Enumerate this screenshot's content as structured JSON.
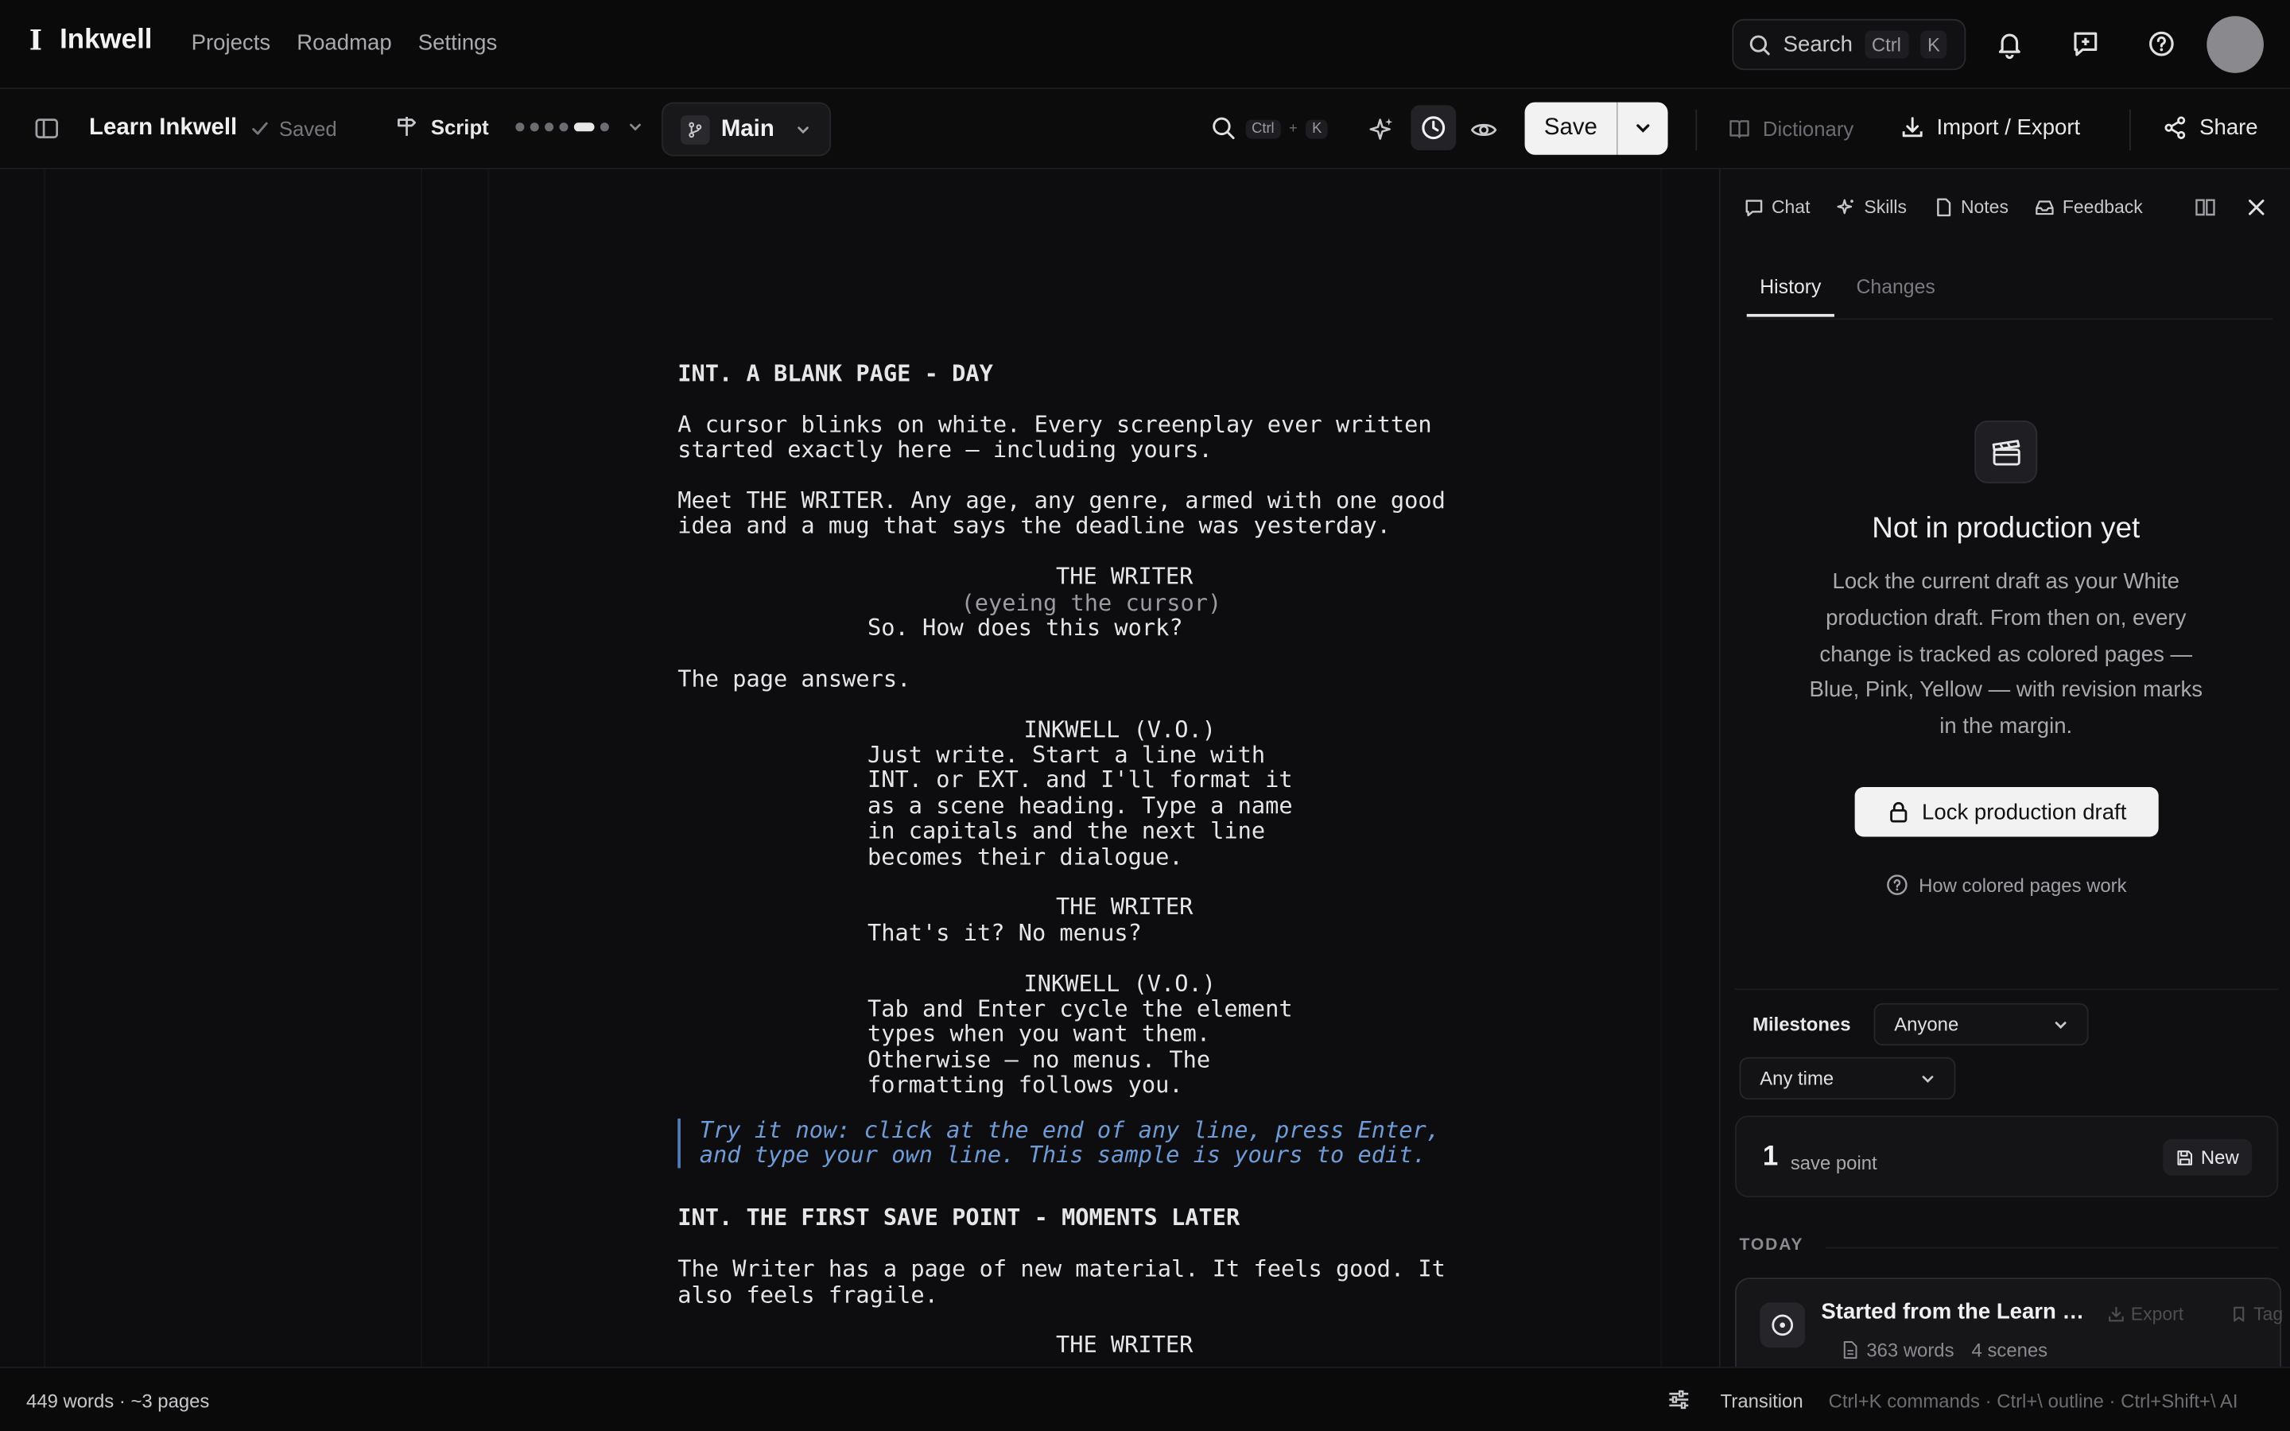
{
  "app": {
    "brand_mark": "I",
    "brand_name": "Inkwell",
    "nav": [
      "Projects",
      "Roadmap",
      "Settings"
    ],
    "search": {
      "label": "Search",
      "key1": "Ctrl",
      "key2": "K"
    }
  },
  "toolbar": {
    "doc_title": "Learn Inkwell",
    "saved_status": "Saved",
    "mode_label": "Script",
    "mode_dots": {
      "count": 6,
      "active_index": 4
    },
    "branch": "Main",
    "find_key1": "Ctrl",
    "find_plus": "+",
    "find_key2": "K",
    "save_label": "Save",
    "dictionary_label": "Dictionary",
    "import_export_label": "Import / Export",
    "share_label": "Share"
  },
  "script": {
    "scene1": "INT. A BLANK PAGE - DAY",
    "action1": "A cursor blinks on white. Every screenplay ever written\nstarted exactly here — including yours.",
    "action2": "Meet THE WRITER. Any age, any genre, armed with one good\nidea and a mug that says the deadline was yesterday.",
    "cue1": "THE WRITER",
    "paren1": "(eyeing the cursor)",
    "dlg1": "So. How does this work?",
    "action3": "The page answers.",
    "cue2": "INKWELL (V.O.)",
    "dlg2": "Just write. Start a line with\nINT. or EXT. and I'll format it\nas a scene heading. Type a name\nin capitals and the next line\nbecomes their dialogue.",
    "cue3": "THE WRITER",
    "dlg3": "That's it? No menus?",
    "cue4": "INKWELL (V.O.)",
    "dlg4": "Tab and Enter cycle the element\ntypes when you want them.\nOtherwise — no menus. The\nformatting follows you.",
    "note": "Try it now: click at the end of any line, press Enter,\nand type your own line. This sample is yours to edit.",
    "scene2": "INT. THE FIRST SAVE POINT - MOMENTS LATER",
    "action4": "The Writer has a page of new material. It feels good. It\nalso feels fragile.",
    "cue5": "THE WRITER"
  },
  "status": {
    "counts": "449 words · ~3 pages",
    "element": "Transition",
    "hints": "Ctrl+K commands · Ctrl+\\ outline · Ctrl+Shift+\\ AI"
  },
  "panel": {
    "tabs": [
      "Chat",
      "Skills",
      "Notes",
      "Feedback"
    ],
    "subtabs": [
      "History",
      "Changes"
    ],
    "empty_title": "Not in production yet",
    "empty_body": "Lock the current draft as your White production draft. From then on, every change is tracked as colored pages — Blue, Pink, Yellow — with revision marks in the margin.",
    "lock_button": "Lock production draft",
    "help_link": "How colored pages work",
    "milestones_label": "Milestones",
    "filter_author": "Anyone",
    "filter_time": "Any time",
    "save_points_count": "1",
    "save_points_label": "save point",
    "new_button": "New",
    "group_label": "TODAY",
    "history_item": {
      "title": "Started from the Learn Inkwell sample",
      "words": "363 words",
      "scenes": "4 scenes",
      "export_label": "Export",
      "tag_label": "Tag"
    }
  },
  "colors": {
    "accent_note": "#6f9bd6",
    "button_light": "#f2f2f3",
    "background": "#0b0b0c"
  }
}
